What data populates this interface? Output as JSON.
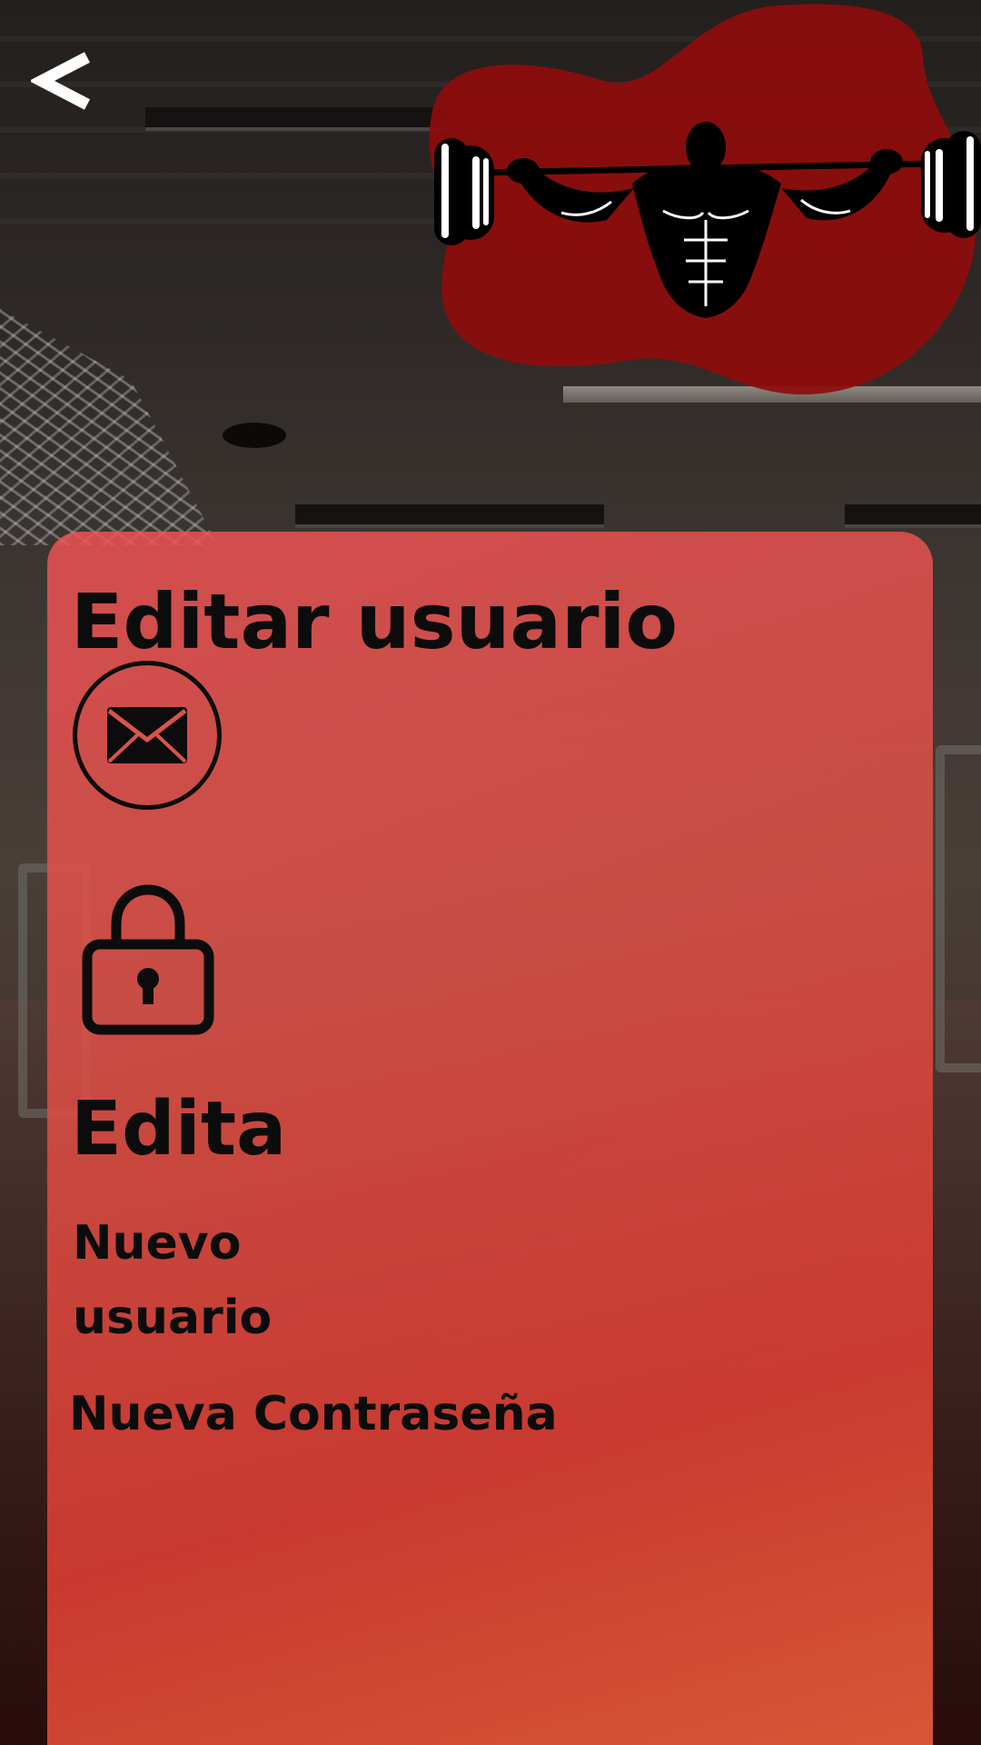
{
  "header": {
    "back_label": "<"
  },
  "logo": {
    "icon": "weightlifter-barbell-logo",
    "blob_color": "#8f0c0c"
  },
  "card": {
    "title": "Editar usuario",
    "email_icon": "envelope-icon",
    "lock_icon": "padlock-icon",
    "section_title": "Edita",
    "fields": {
      "new_user_label": "Nuevo usuario",
      "new_password_label": "Nueva Contraseña"
    }
  },
  "colors": {
    "accent": "#e0463f",
    "text": "#0c0c0c"
  }
}
